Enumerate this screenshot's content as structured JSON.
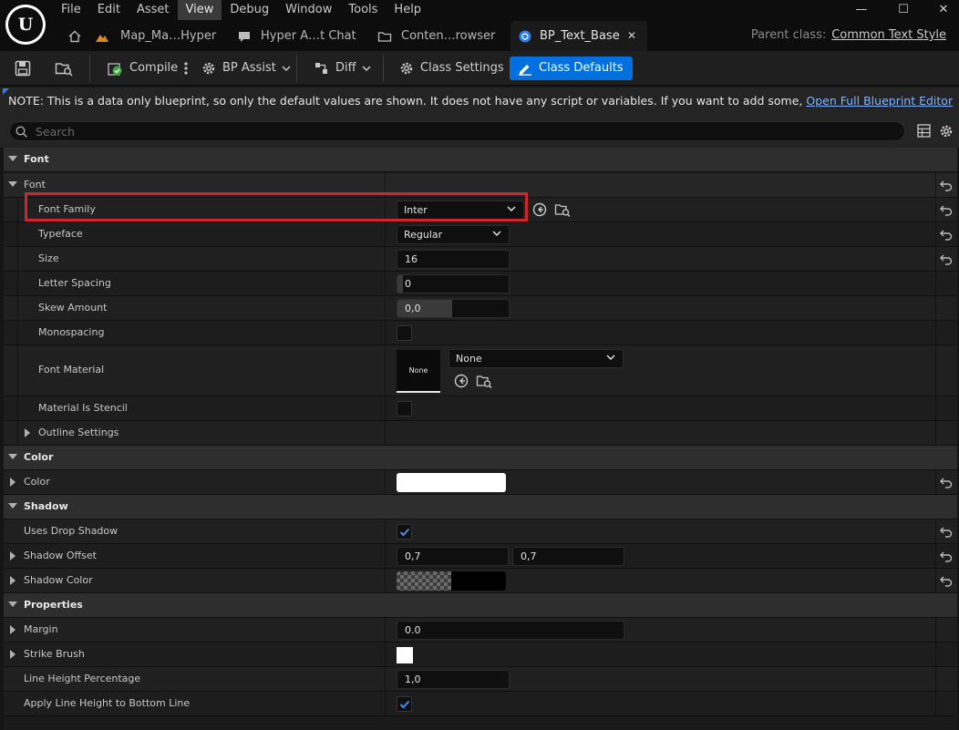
{
  "app": {
    "logo_letter": "U"
  },
  "menu": [
    "File",
    "Edit",
    "Asset",
    "View",
    "Debug",
    "Window",
    "Tools",
    "Help"
  ],
  "window_controls": {
    "minimize": "—",
    "maximize": "☐",
    "close": "✕"
  },
  "tabs": [
    {
      "label": "Map_Ma…Hyper"
    },
    {
      "label": "Hyper A…t Chat"
    },
    {
      "label": "Conten…rowser"
    },
    {
      "label": "BP_Text_Base",
      "close": "✕"
    }
  ],
  "parent_class": {
    "label": "Parent class:",
    "value": "Common Text Style"
  },
  "toolbar": {
    "compile": "Compile",
    "bp_assist": "BP Assist",
    "diff": "Diff",
    "class_settings": "Class Settings",
    "class_defaults": "Class Defaults"
  },
  "note": {
    "text": "NOTE: This is a data only blueprint, so only the default values are shown.  It does not have any script or variables.  If you want to add some,",
    "link": "Open Full Blueprint Editor"
  },
  "search": {
    "placeholder": "Search"
  },
  "grid": {
    "cat_font": "Font",
    "sub_font": "Font",
    "font_family": {
      "label": "Font Family",
      "value": "Inter"
    },
    "typeface": {
      "label": "Typeface",
      "value": "Regular"
    },
    "size": {
      "label": "Size",
      "value": "16"
    },
    "letter_spacing": {
      "label": "Letter Spacing",
      "value": "0"
    },
    "skew_amount": {
      "label": "Skew Amount",
      "value": "0,0"
    },
    "monospacing": {
      "label": "Monospacing",
      "checked": false
    },
    "font_material": {
      "label": "Font Material",
      "thumb": "None",
      "value": "None"
    },
    "material_is_stencil": {
      "label": "Material Is Stencil",
      "checked": false
    },
    "outline_settings": {
      "label": "Outline Settings"
    },
    "cat_color": "Color",
    "color": {
      "label": "Color",
      "value": "#ffffff"
    },
    "cat_shadow": "Shadow",
    "uses_drop_shadow": {
      "label": "Uses Drop Shadow",
      "checked": true
    },
    "shadow_offset": {
      "label": "Shadow Offset",
      "x": "0,7",
      "y": "0,7"
    },
    "shadow_color": {
      "label": "Shadow Color",
      "value": "#000000"
    },
    "cat_properties": "Properties",
    "margin": {
      "label": "Margin",
      "value": "0.0"
    },
    "strike_brush": {
      "label": "Strike Brush",
      "value": "#ffffff"
    },
    "line_height_percentage": {
      "label": "Line Height Percentage",
      "value": "1,0"
    },
    "apply_line_height": {
      "label": "Apply Line Height to Bottom Line",
      "checked": true
    }
  },
  "colors": {
    "accent": "#0070e0",
    "highlight": "#d3232b",
    "link": "#7fb3ff"
  }
}
